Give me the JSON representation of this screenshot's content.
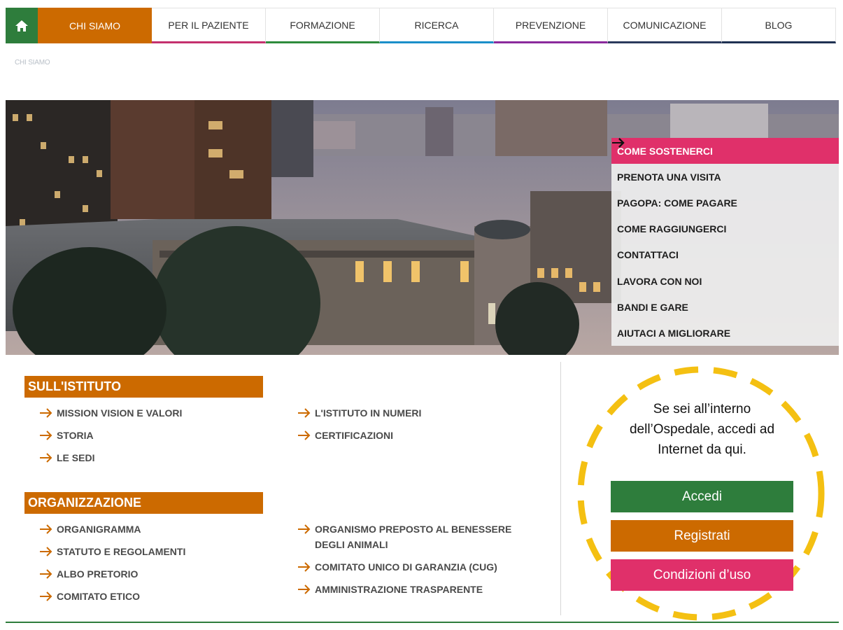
{
  "nav": {
    "items": [
      {
        "label": "CHI SIAMO",
        "accent": "#cc6a00",
        "active": true
      },
      {
        "label": "PER IL PAZIENTE",
        "accent": "#c4306e"
      },
      {
        "label": "FORMAZIONE",
        "accent": "#2e8b3c"
      },
      {
        "label": "RICERCA",
        "accent": "#1a8fc9"
      },
      {
        "label": "PREVENZIONE",
        "accent": "#8a2a9c"
      },
      {
        "label": "COMUNICAZIONE",
        "accent": "#2b3a5c"
      },
      {
        "label": "BLOG",
        "accent": "#1f3152"
      }
    ]
  },
  "breadcrumb": "CHI SIAMO",
  "quick_links": [
    {
      "label": "COME SOSTENERCI",
      "active": true
    },
    {
      "label": "PRENOTA UNA VISITA"
    },
    {
      "label": "PAGOPA: COME PAGARE"
    },
    {
      "label": "COME RAGGIUNGERCI"
    },
    {
      "label": "CONTATTACI"
    },
    {
      "label": "LAVORA CON NOI"
    },
    {
      "label": "BANDI E GARE"
    },
    {
      "label": "AIUTACI A MIGLIORARE"
    }
  ],
  "istituto": {
    "title": "SULL'ISTITUTO",
    "col1": [
      "MISSION VISION E VALORI",
      "STORIA",
      "LE SEDI"
    ],
    "col2": [
      "L'ISTITUTO IN NUMERI",
      "CERTIFICAZIONI"
    ]
  },
  "organizzazione": {
    "title": "ORGANIZZAZIONE",
    "col1": [
      "ORGANIGRAMMA",
      "STATUTO E REGOLAMENTI",
      "ALBO PRETORIO",
      "COMITATO ETICO"
    ],
    "col2": [
      "ORGANISMO PREPOSTO AL BENESSERE DEGLI ANIMALI",
      "COMITATO UNICO DI GARANZIA (CUG)",
      "AMMINISTRAZIONE TRASPARENTE"
    ]
  },
  "wifi": {
    "intro_line1": "Se sei all’interno",
    "intro_line2": "dell’Ospedale, accedi ad",
    "intro_line3": "Internet da qui.",
    "login": "Accedi",
    "register": "Registrati",
    "terms": "Condizioni d’uso",
    "ring_color": "#f4c012"
  },
  "colors": {
    "orange": "#cc6a00",
    "green": "#2e7d3c",
    "pink": "#e0306a"
  }
}
